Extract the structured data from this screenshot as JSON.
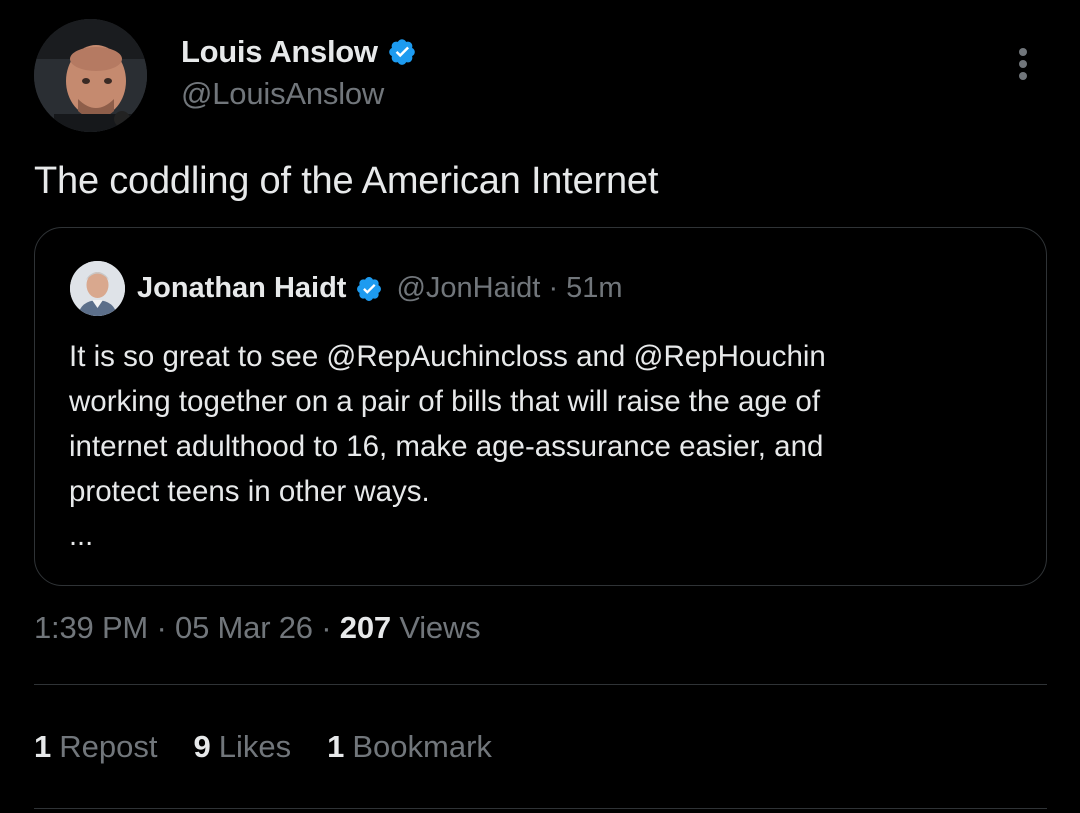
{
  "author": {
    "name": "Louis Anslow",
    "handle": "@LouisAnslow"
  },
  "tweet": {
    "text": "The coddling of the American Internet"
  },
  "quote": {
    "name": "Jonathan Haidt",
    "handle": "@JonHaidt",
    "separator": "·",
    "time": "51m",
    "lines": [
      "It is so great to see @RepAuchincloss and @RepHouchin",
      "working together on a pair of bills that will raise the age of",
      "internet adulthood to 16, make age-assurance easier, and",
      "protect teens in other ways."
    ],
    "more": "..."
  },
  "meta": {
    "time": "1:39 PM",
    "sep1": "·",
    "date": "05 Mar 26",
    "sep2": "·",
    "views_count": "207",
    "views_label": "Views"
  },
  "stats": {
    "reposts_count": "1",
    "reposts_label": "Repost",
    "likes_count": "9",
    "likes_label": "Likes",
    "bookmarks_count": "1",
    "bookmarks_label": "Bookmark"
  },
  "colors": {
    "background": "#000000",
    "text_primary": "#e7e9ea",
    "text_secondary": "#71767b",
    "border": "#2f3336",
    "verified_blue": "#1d9bf0"
  },
  "icons": {
    "verified": "verified-badge-icon",
    "more": "more-options-icon"
  }
}
